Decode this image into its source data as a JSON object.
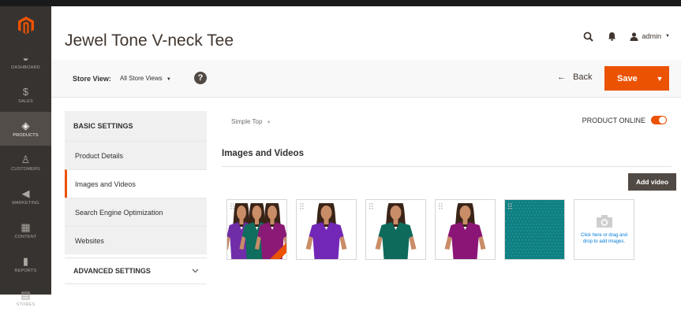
{
  "sidebar": {
    "items": [
      {
        "label": "DASHBOARD",
        "icon": "dashboard-icon",
        "glyph": "◒"
      },
      {
        "label": "SALES",
        "icon": "dollar-icon",
        "glyph": "$"
      },
      {
        "label": "PRODUCTS",
        "icon": "cube-icon",
        "glyph": "◈",
        "active": true
      },
      {
        "label": "CUSTOMERS",
        "icon": "person-icon",
        "glyph": "♙"
      },
      {
        "label": "MARKETING",
        "icon": "megaphone-icon",
        "glyph": "◀"
      },
      {
        "label": "CONTENT",
        "icon": "layout-icon",
        "glyph": "▦"
      },
      {
        "label": "REPORTS",
        "icon": "bar-chart-icon",
        "glyph": "▮"
      },
      {
        "label": "STORES",
        "icon": "store-icon",
        "glyph": "▤"
      }
    ]
  },
  "header": {
    "title": "Jewel Tone V-neck Tee",
    "user": "admin"
  },
  "toolbar": {
    "store_view_label": "Store View:",
    "store_view_value": "All Store Views",
    "back_label": "Back",
    "save_label": "Save"
  },
  "settings": {
    "basic_heading": "BASIC SETTINGS",
    "items": [
      {
        "label": "Product Details"
      },
      {
        "label": "Images and Videos",
        "active": true
      },
      {
        "label": "Search Engine Optimization"
      },
      {
        "label": "Websites"
      }
    ],
    "advanced_heading": "ADVANCED SETTINGS"
  },
  "main": {
    "attribute_set": "Simple Top",
    "product_online_label": "PRODUCT ONLINE",
    "product_online": true,
    "section_title": "Images and Videos",
    "add_video_label": "Add video",
    "upload_text": "Click here or drag and drop to add images.",
    "images": [
      {
        "name": "group-shot",
        "colors": [
          "#6f2da8",
          "#0f6e5d",
          "#8a1a76"
        ],
        "base": true
      },
      {
        "name": "purple-tee",
        "colors": [
          "#7327b7"
        ]
      },
      {
        "name": "teal-tee",
        "colors": [
          "#0e6b5c"
        ]
      },
      {
        "name": "plum-tee",
        "colors": [
          "#8b1577"
        ]
      },
      {
        "name": "teal-swatch",
        "colors": [
          "#0f7f83"
        ]
      }
    ]
  },
  "colors": {
    "accent": "#eb5202",
    "sidebar": "#373330",
    "dark_button": "#514943"
  }
}
